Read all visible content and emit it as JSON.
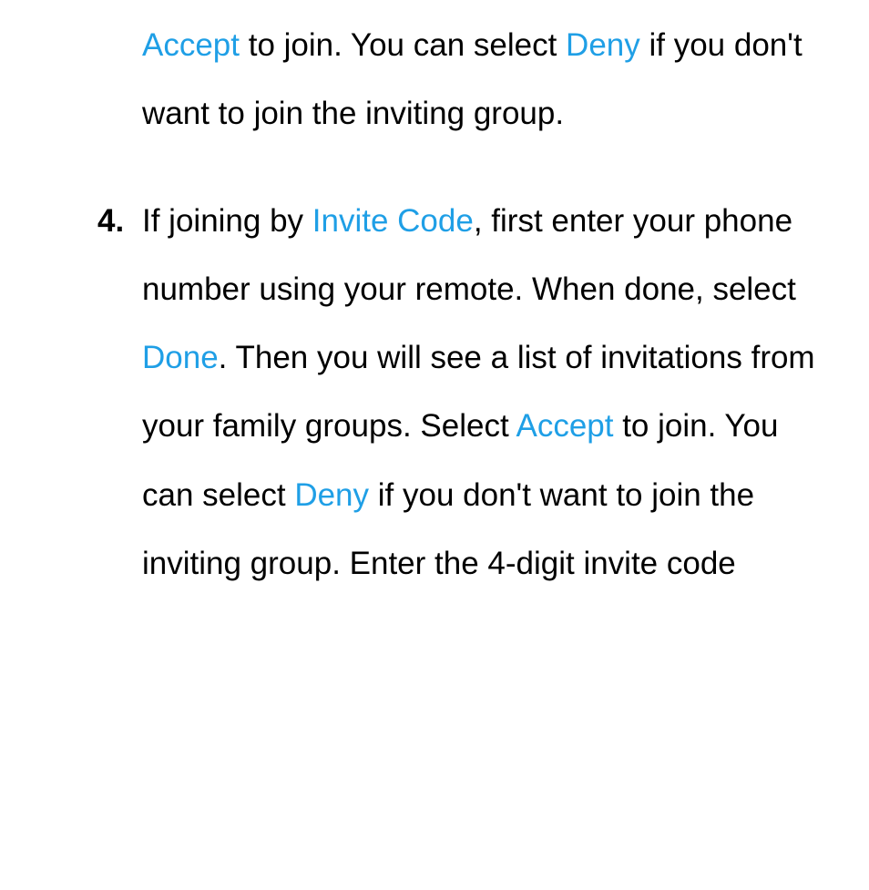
{
  "step3": {
    "segments": [
      {
        "text": "Accept",
        "highlight": true
      },
      {
        "text": " to join. You can select ",
        "highlight": false
      },
      {
        "text": "Deny",
        "highlight": true
      },
      {
        "text": " if you don't want to join the inviting group.",
        "highlight": false
      }
    ]
  },
  "step4": {
    "number": "4.",
    "segments": [
      {
        "text": "If joining by ",
        "highlight": false
      },
      {
        "text": "Invite Code",
        "highlight": true
      },
      {
        "text": ", first enter your phone number using your remote. When done, select ",
        "highlight": false
      },
      {
        "text": "Done",
        "highlight": true
      },
      {
        "text": ". Then you will see a list of invitations from your family groups. Select ",
        "highlight": false
      },
      {
        "text": "Accept",
        "highlight": true
      },
      {
        "text": " to join. You can select ",
        "highlight": false
      },
      {
        "text": "Deny",
        "highlight": true
      },
      {
        "text": " if you don't want to join the inviting group. Enter the 4-digit invite code",
        "highlight": false
      }
    ]
  }
}
